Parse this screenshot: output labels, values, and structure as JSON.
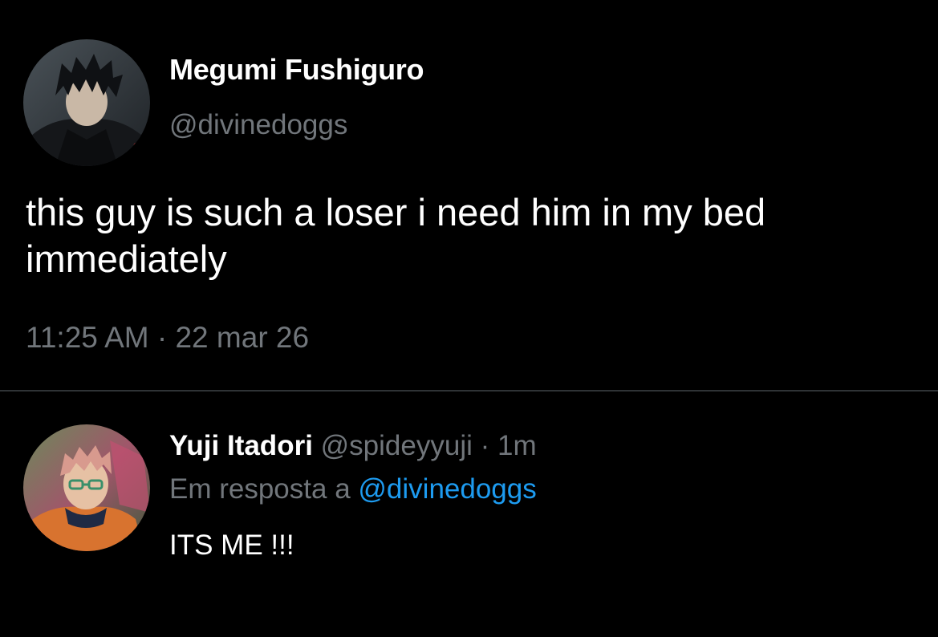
{
  "main_tweet": {
    "display_name": "Megumi Fushiguro",
    "handle": "@divinedoggs",
    "text": "this guy is such a loser i need him in my bed immediately",
    "time": "11:25 AM",
    "separator": "·",
    "date": "22 mar 26"
  },
  "reply": {
    "display_name": "Yuji Itadori",
    "handle": "@spideyyuji",
    "separator": "·",
    "time": "1m",
    "context_prefix": "Em resposta a",
    "context_mention": "@divinedoggs",
    "text": "ITS ME !!!"
  },
  "colors": {
    "background": "#000000",
    "primary_text": "#ffffff",
    "secondary_text": "#71767b",
    "link": "#1d9bf0",
    "divider": "#2f3336"
  }
}
